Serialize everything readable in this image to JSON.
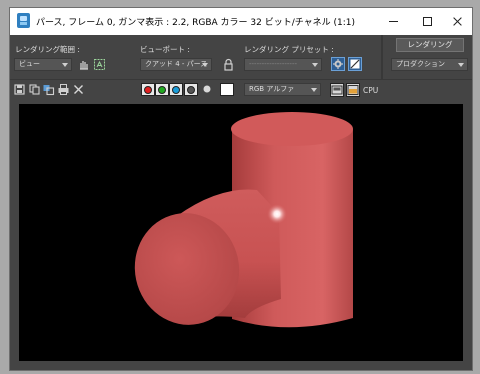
{
  "window": {
    "title": "パース, フレーム 0, ガンマ表示 : 2.2, RGBA カラー 32 ビット/チャネル (1:1)"
  },
  "render_settings": {
    "area_label": "レンダリング範囲 :",
    "area_value": "ビュー",
    "viewport_label": "ビューポート :",
    "viewport_value": "クアッド 4 - パース",
    "preset_label": "レンダリング プリセット :",
    "preset_value": "-------------------",
    "render_button": "レンダリング",
    "mode_value": "プロダクション"
  },
  "toolbar": {
    "channel_value": "RGB アルファ",
    "cpu_label": "CPU"
  },
  "colors": {
    "red_channel": "#e02020",
    "green_channel": "#22aa22",
    "blue_channel": "#1a9cd8",
    "object_color": "#d15a5a",
    "background": "#000000"
  }
}
